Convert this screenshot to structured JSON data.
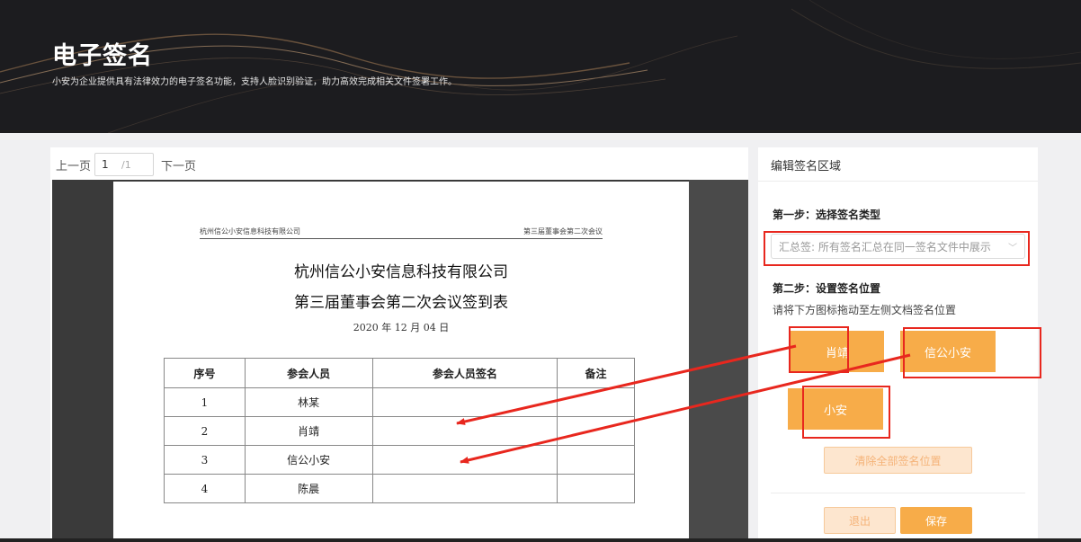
{
  "banner": {
    "title": "电子签名",
    "subtitle": "小安为企业提供具有法律效力的电子签名功能，支持人脸识别验证，助力高效完成相关文件签署工作。"
  },
  "pager": {
    "prev": "上一页",
    "current": "1",
    "total": "/1",
    "next": "下一页"
  },
  "document": {
    "header_left": "杭州信公小安信息科技有限公司",
    "header_right": "第三届董事会第二次会议",
    "title1": "杭州信公小安信息科技有限公司",
    "title2": "第三届董事会第二次会议签到表",
    "date": "2020 年 12 月 04 日",
    "columns": [
      "序号",
      "参会人员",
      "参会人员签名",
      "备注"
    ],
    "rows": [
      {
        "no": "1",
        "name": "林某",
        "signature": "",
        "note": ""
      },
      {
        "no": "2",
        "name": "肖靖",
        "signature": "",
        "note": ""
      },
      {
        "no": "3",
        "name": "信公小安",
        "signature": "",
        "note": ""
      },
      {
        "no": "4",
        "name": "陈晨",
        "signature": "",
        "note": ""
      }
    ]
  },
  "panel": {
    "title": "编辑签名区域",
    "step1_title": "第一步：选择签名类型",
    "sign_type_value": "汇总签: 所有签名汇总在同一签名文件中展示",
    "step2_title": "第二步：设置签名位置",
    "step2_hint": "请将下方图标拖动至左侧文档签名位置",
    "chips": [
      "肖靖",
      "信公小安",
      "小安"
    ],
    "clear_label": "清除全部签名位置",
    "exit_label": "退出",
    "save_label": "保存"
  },
  "colors": {
    "accent": "#f7ac49",
    "annotation": "#e8271e",
    "banner_bg": "#1c1c1f"
  },
  "icons": {
    "select_arrow": "chevron-down-icon"
  }
}
